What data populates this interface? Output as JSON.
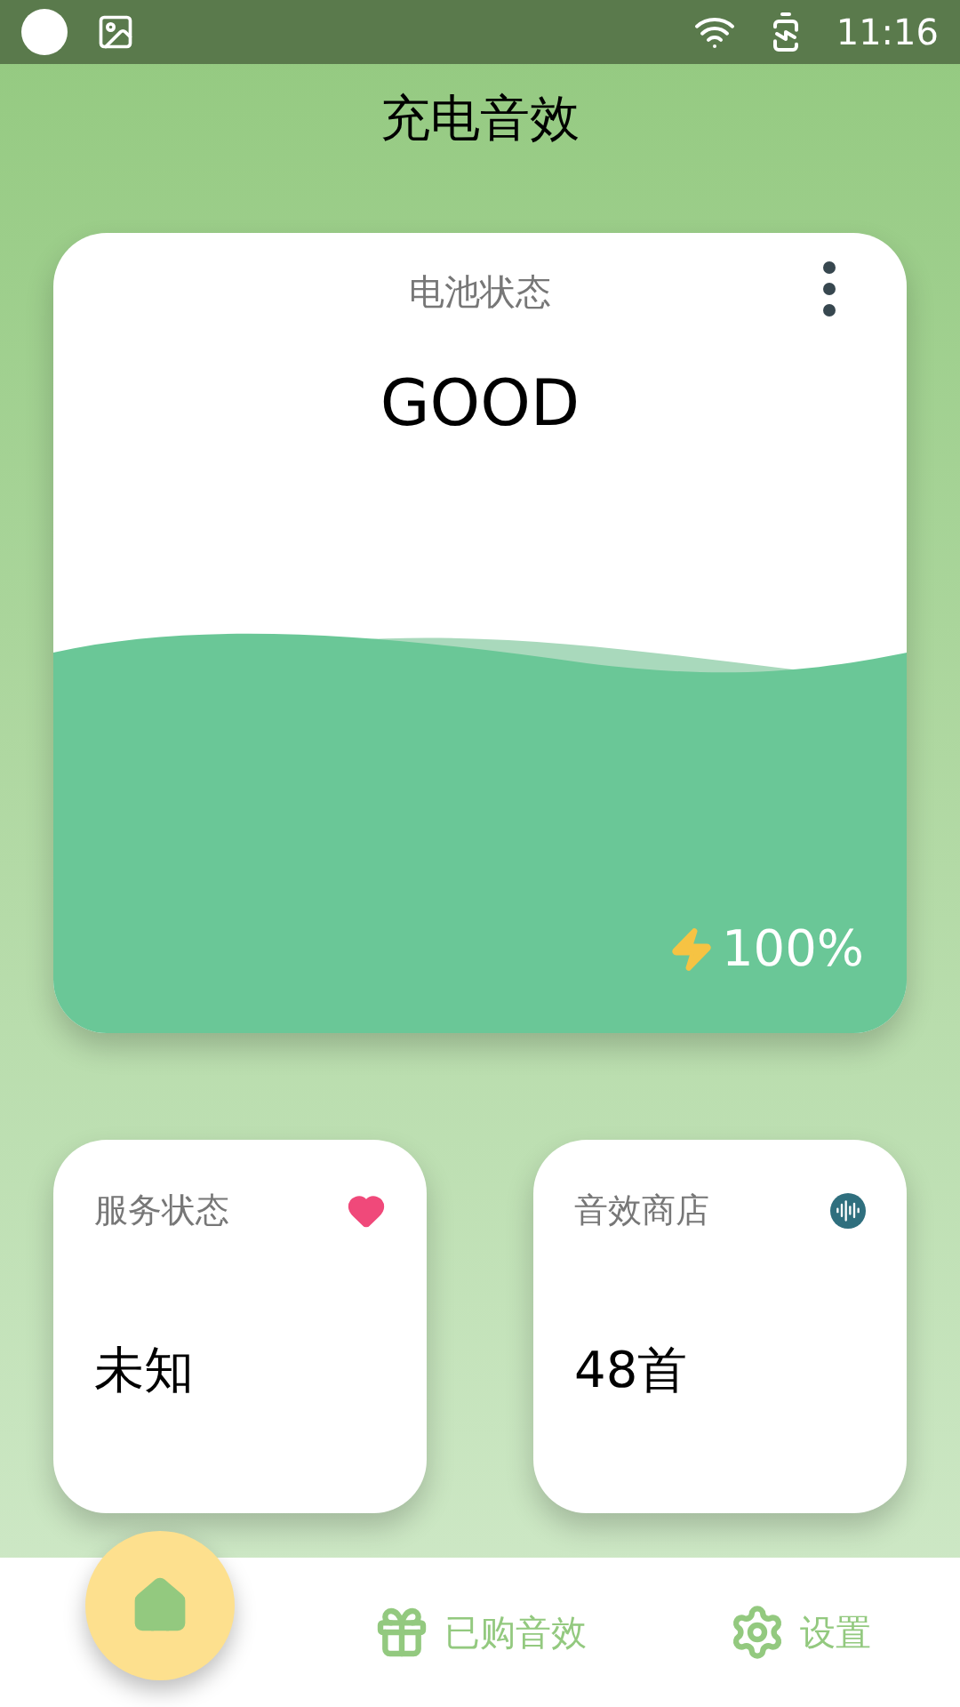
{
  "status_bar": {
    "time": "11:16"
  },
  "app_bar": {
    "title": "充电音效"
  },
  "battery_card": {
    "title": "电池状态",
    "status": "GOOD",
    "charging": true,
    "percent": "100%"
  },
  "info_cards": [
    {
      "kind": "service",
      "title": "服务状态",
      "value": "未知"
    },
    {
      "kind": "store",
      "title": "音效商店",
      "value": "48首"
    }
  ],
  "nav": [
    {
      "kind": "home",
      "selected": true
    },
    {
      "kind": "gift",
      "label": "已购音效",
      "selected": false
    },
    {
      "kind": "gear",
      "label": "设置",
      "selected": false
    }
  ]
}
